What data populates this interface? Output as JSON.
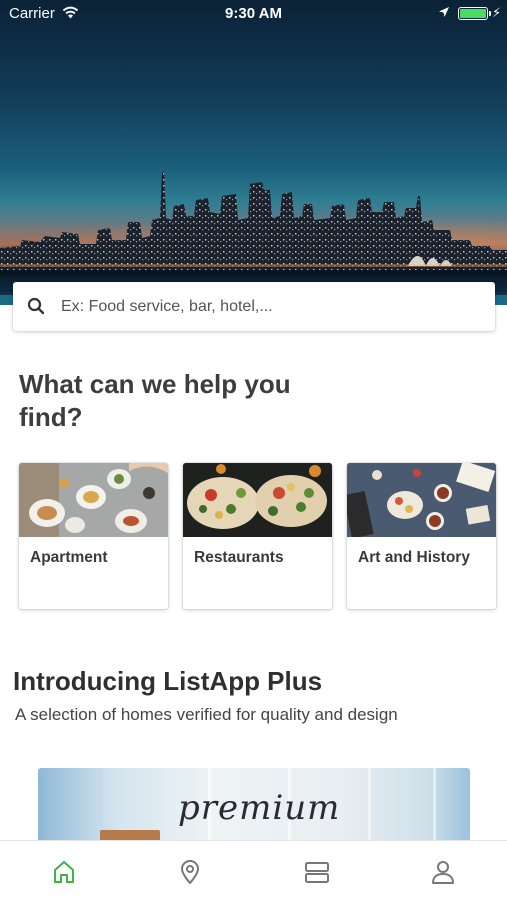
{
  "status_bar": {
    "carrier": "Carrier",
    "time": "9:30 AM",
    "battery_color": "#4cd964"
  },
  "search": {
    "placeholder": "Ex: Food service, bar, hotel,...",
    "icon": "search-icon"
  },
  "help_section": {
    "title": "What can we help you find?"
  },
  "categories": [
    {
      "label": "Apartment",
      "image": "dining-table-photo"
    },
    {
      "label": "Restaurants",
      "image": "flatbread-pizza-photo"
    },
    {
      "label": "Art and History",
      "image": "tea-and-desserts-photo"
    }
  ],
  "plus_section": {
    "title": "Introducing ListApp Plus",
    "subtitle": "A selection of homes verified for quality and design",
    "banner_word": "premium"
  },
  "tab_bar": {
    "active_color": "#3cb34a",
    "inactive_color": "#777777",
    "items": [
      {
        "name": "home",
        "icon": "home-icon",
        "active": true
      },
      {
        "name": "location",
        "icon": "map-pin-icon",
        "active": false
      },
      {
        "name": "listings",
        "icon": "listings-icon",
        "active": false
      },
      {
        "name": "profile",
        "icon": "user-icon",
        "active": false
      }
    ]
  }
}
